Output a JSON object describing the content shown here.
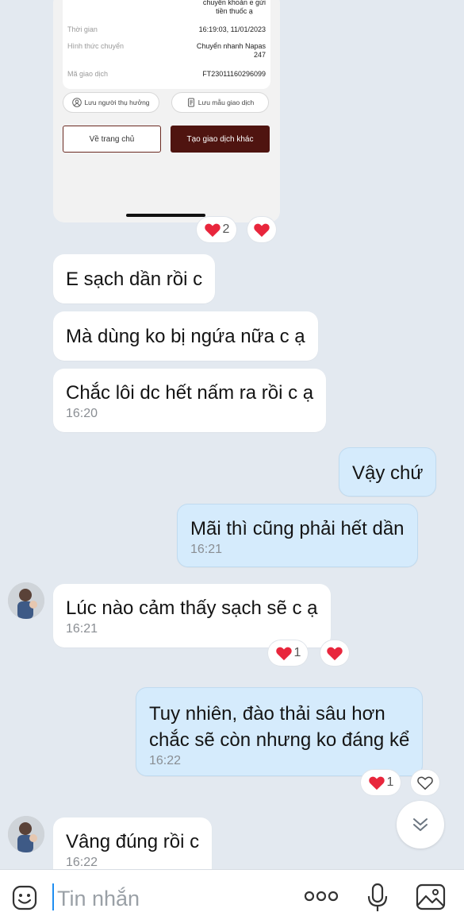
{
  "receipt": {
    "note_line1": "chuyển khoản e gửi",
    "note_line2": "tiền thuốc ạ",
    "time_label": "Thời gian",
    "time_value": "16:19:03, 11/01/2023",
    "method_label": "Hình thức chuyển",
    "method_value_line1": "Chuyển nhanh Napas",
    "method_value_line2": "247",
    "txn_label": "Mã giao dịch",
    "txn_value": "FT23011160296099",
    "save_beneficiary": "Lưu người thụ hưởng",
    "save_template": "Lưu mẫu giao dịch",
    "home_button": "Về trang chủ",
    "new_txn_button": "Tạo giao dịch khác",
    "reaction_count": "2"
  },
  "messages": [
    {
      "text": "E sạch dần rồi c"
    },
    {
      "text": "Mà dùng ko bị ngứa nữa c ạ"
    },
    {
      "text": "Chắc lôi dc hết nấm ra rồi c ạ",
      "time": "16:20"
    },
    {
      "text": "Vậy chứ"
    },
    {
      "text": "Mãi thì cũng phải hết dần",
      "time": "16:21"
    },
    {
      "text": "Lúc nào cảm thấy sạch sẽ c ạ",
      "time": "16:21",
      "reaction_count": "1"
    },
    {
      "line1": "Tuy nhiên, đào thải sâu hơn",
      "line2": "chắc sẽ còn nhưng ko đáng kể",
      "time": "16:22",
      "reaction_count": "1"
    },
    {
      "text": "Vâng đúng rồi c",
      "time": "16:22"
    }
  ],
  "input": {
    "placeholder": "Tin nhắn"
  },
  "colors": {
    "background": "#e3e9f0",
    "outgoing_bubble": "#d5ebfc",
    "incoming_bubble": "#ffffff",
    "heart": "#e8263c",
    "bank_primary": "#4f1410"
  }
}
